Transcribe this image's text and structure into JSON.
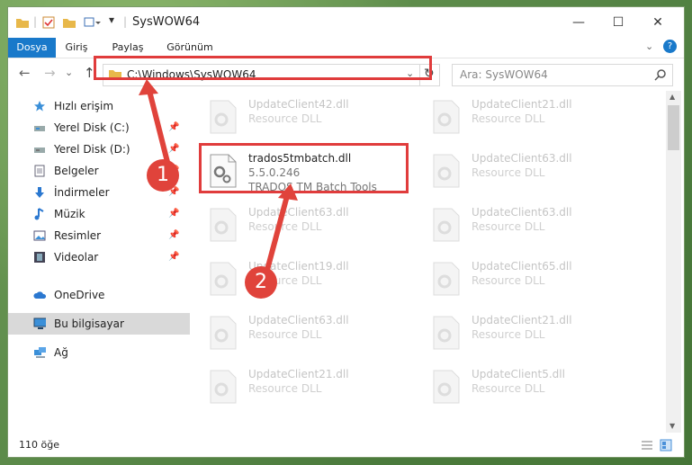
{
  "window": {
    "title": "SysWOW64",
    "min": "—",
    "max": "☐",
    "close": "✕"
  },
  "ribbon": {
    "tabs": [
      "Dosya",
      "Giriş",
      "Paylaş",
      "Görünüm"
    ]
  },
  "nav": {
    "back": "←",
    "forward": "→",
    "recent": "⌄",
    "up": "↑",
    "address": "C:\\Windows\\SysWOW64",
    "refresh": "↻",
    "search_placeholder": "Ara: SysWOW64"
  },
  "sidebar": {
    "items": [
      {
        "label": "Hızlı erişim",
        "icon": "star-icon"
      },
      {
        "label": "Yerel Disk (C:)",
        "icon": "drive-icon",
        "pinned": true
      },
      {
        "label": "Yerel Disk (D:)",
        "icon": "drive-icon",
        "pinned": true
      },
      {
        "label": "Belgeler",
        "icon": "document-icon",
        "pinned": true
      },
      {
        "label": "İndirmeler",
        "icon": "download-icon",
        "pinned": true
      },
      {
        "label": "Müzik",
        "icon": "music-icon",
        "pinned": true
      },
      {
        "label": "Resimler",
        "icon": "picture-icon",
        "pinned": true
      },
      {
        "label": "Videolar",
        "icon": "video-icon",
        "pinned": true
      },
      {
        "label": "OneDrive",
        "icon": "cloud-icon"
      },
      {
        "label": "Bu bilgisayar",
        "icon": "computer-icon",
        "selected": true
      },
      {
        "label": "Ağ",
        "icon": "network-icon"
      }
    ]
  },
  "files": [
    {
      "name": "UpdateClient42.dll",
      "type": "Resource DLL"
    },
    {
      "name": "UpdateClient21.dll",
      "type": "Resource DLL"
    },
    {
      "name": "trados5tmbatch.dll",
      "version": "5.5.0.246",
      "desc": "TRADOS TM Batch Tools",
      "highlighted": true
    },
    {
      "name": "UpdateClient63.dll",
      "type": "Resource DLL"
    },
    {
      "name": "UpdateClient63.dll",
      "type": "Resource DLL"
    },
    {
      "name": "UpdateClient63.dll",
      "type": "Resource DLL"
    },
    {
      "name": "UpdateClient19.dll",
      "type": "Resource DLL"
    },
    {
      "name": "UpdateClient65.dll",
      "type": "Resource DLL"
    },
    {
      "name": "UpdateClient63.dll",
      "type": "Resource DLL"
    },
    {
      "name": "UpdateClient21.dll",
      "type": "Resource DLL"
    },
    {
      "name": "UpdateClient21.dll",
      "type": "Resource DLL"
    },
    {
      "name": "UpdateClient5.dll",
      "type": "Resource DLL"
    }
  ],
  "status": {
    "count": "110 öğe"
  },
  "markers": [
    "1",
    "2"
  ],
  "colors": {
    "accent": "#1979ca",
    "annotation": "#e03c3c"
  }
}
